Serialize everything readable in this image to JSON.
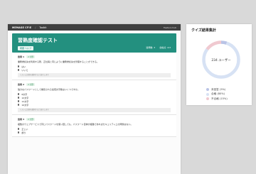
{
  "topbar": {
    "brand": "MEMAGE CF!E",
    "sep": "/",
    "module": "Toolkit",
    "right": "Feature hub"
  },
  "quiz": {
    "title": "習熟度確認テスト",
    "chip": "概要 ヘルプ",
    "meta_questions": "質問数: 3",
    "meta_score": "合格点: 2/3"
  },
  "questions": [
    {
      "num": "質問 1",
      "tag": "2 分野",
      "text": "業務委託先を利用する際、正社員と同じように業務委託先を管理することができる。",
      "options": [
        "はい",
        "いいえ"
      ],
      "note": "リストに回答を選択すると表示します"
    },
    {
      "num": "質問 2",
      "tag": "2 分野",
      "text": "強力なパスワードとして推奨される最低文字数はいくつですか。",
      "options": [
        "8文字",
        "10文字",
        "12文字",
        "16文字"
      ],
      "note": "リストに回答を選択すると表示します"
    },
    {
      "num": "質問 3",
      "tag": "2 分野",
      "text": "複数のウェブサービスで同じパスワードを使い回しても、パスワード自体が複雑であればセキュリティ上の問題はない。",
      "options": [
        "正しい",
        "誤り"
      ],
      "note": ""
    }
  ],
  "summary": {
    "title": "クイズ結果集計",
    "center_label": "234 ユーザー",
    "legend": [
      {
        "label": "未回答 (5%)",
        "value": 5,
        "color": "#b9c3e6"
      },
      {
        "label": "合格 (80%)",
        "value": 80,
        "color": "#d7e2f4"
      },
      {
        "label": "不合格 (15%)",
        "value": 15,
        "color": "#f0c9d0"
      }
    ]
  }
}
